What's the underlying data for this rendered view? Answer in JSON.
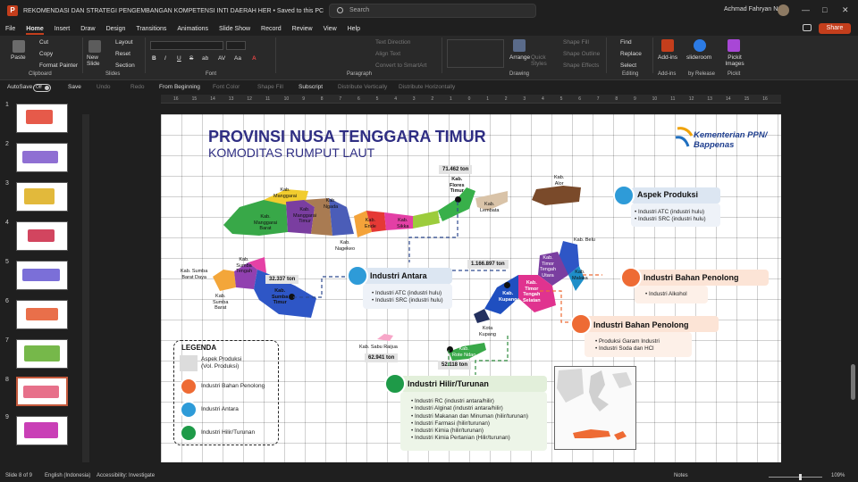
{
  "window": {
    "app_letter": "P",
    "doc_title": "REKOMENDASI DAN STRATEGI PENGEMBANGAN KOMPETENSI INTI DAERAH HER • Saved to this PC",
    "search_placeholder": "Search",
    "user_name": "Achmad Fahryan Nur",
    "controls": [
      "—",
      "□",
      "✕"
    ]
  },
  "menu": {
    "tabs": [
      "File",
      "Home",
      "Insert",
      "Draw",
      "Design",
      "Transitions",
      "Animations",
      "Slide Show",
      "Record",
      "Review",
      "View",
      "Help"
    ],
    "active": "Home",
    "share_label": "Share"
  },
  "ribbon": {
    "clipboard": {
      "paste": "Paste",
      "cut": "Cut",
      "copy": "Copy",
      "format_painter": "Format Painter",
      "label": "Clipboard"
    },
    "slides": {
      "new_slide": "New Slide",
      "layout": "Layout",
      "reset": "Reset",
      "section": "Section",
      "label": "Slides"
    },
    "font": {
      "label": "Font",
      "buttons": [
        "B",
        "I",
        "U",
        "S",
        "ab",
        "AV",
        "Aa",
        "A"
      ]
    },
    "paragraph": {
      "label": "Paragraph",
      "text_direction": "Text Direction",
      "align_text": "Align Text",
      "convert_smartart": "Convert to SmartArt"
    },
    "drawing": {
      "label": "Drawing",
      "arrange": "Arrange",
      "quick_styles": "Quick Styles",
      "shape_fill": "Shape Fill",
      "shape_outline": "Shape Outline",
      "shape_effects": "Shape Effects"
    },
    "editing": {
      "label": "Editing",
      "find": "Find",
      "replace": "Replace",
      "select": "Select"
    },
    "addins": {
      "label": "Add-ins",
      "addins_btn": "Add-ins",
      "slideroom": "slideroom",
      "by_release": "by Release",
      "pickit": "Pickit Images",
      "pickit_label": "Pickit"
    }
  },
  "qat": {
    "autosave": "AutoSave",
    "autosave_state": "Off",
    "save": "Save",
    "undo": "Undo",
    "redo": "Redo",
    "from_beginning": "From Beginning",
    "font_color": "Font Color",
    "shape_fill": "Shape Fill",
    "subscript": "Subscript",
    "distribute_v": "Distribute Vertically",
    "distribute_h": "Distribute Horizontally"
  },
  "thumbnails": {
    "numbers": [
      "1",
      "2",
      "3",
      "4",
      "5",
      "6",
      "7",
      "8",
      "9"
    ],
    "selected": 8
  },
  "ruler": {
    "ticks": [
      "16",
      "15",
      "14",
      "13",
      "12",
      "11",
      "10",
      "9",
      "8",
      "7",
      "6",
      "5",
      "4",
      "3",
      "2",
      "1",
      "0",
      "1",
      "2",
      "3",
      "4",
      "5",
      "6",
      "7",
      "8",
      "9",
      "10",
      "11",
      "12",
      "13",
      "14",
      "15",
      "16"
    ]
  },
  "slide": {
    "title": "PROVINSI NUSA TENGGARA TIMUR",
    "subtitle": "KOMODITAS RUMPUT LAUT",
    "logo_line1": "Kementerian PPN/",
    "logo_line2": "Bappenas",
    "map_labels": {
      "manggarai": "Kab.\nManggarai",
      "manggarai_barat": "Kab.\nManggarai\nBarat",
      "manggarai_timur": "Kab.\nManggarai\nTimur",
      "ngada": "Kab.\nNgada",
      "nagekeo": "Kab.\nNagekeo",
      "ende": "Kab.\nEnde",
      "sikka": "Kab.\nSikka",
      "flores_timur": "Kab.\nFlores\nTimur",
      "lembata": "Kab.\nLembata",
      "alor": "Kab.\nAlor",
      "belu": "Kab. Belu",
      "ttu": "Kab.\nTimor\nTengah\nUtara",
      "malaka": "Kab.\nMalaka",
      "tts": "Kab.\nTimor\nTengah\nSelatan",
      "kupang": "Kab.\nKupang",
      "kota_kupang": "Kota\nKupang",
      "rote_ndao": "Kab.\nRote Ndao",
      "sabu_raijua": "Kab. Sabu Raijua",
      "sumba_barat_daya": "Kab. Sumba\nBarat Daya",
      "sumba_tengah": "Kab.\nSumba\nTengah",
      "sumba_timur": "Kab.\nSumba\nTimur",
      "sumba_barat": "Kab.\nSumba\nBarat"
    },
    "tonnage": {
      "flores": "71.462 ton",
      "timor": "1.166.897 ton",
      "sumba": "32.337 ton",
      "sabu": "62.941 ton",
      "rote": "52.118 ton"
    },
    "aspek_produksi": {
      "title": "Aspek Produksi",
      "items": [
        "Industri ATC (industri hulu)",
        "Industri SRC (industri hulu)"
      ]
    },
    "industri_antara": {
      "title": "Industri Antara",
      "items": [
        "Industri ATC (industri hulu)",
        "Industri SRC (industri hulu)"
      ]
    },
    "bahan_penolong_1": {
      "title": "Industri Bahan Penolong",
      "items": [
        "Industri Alkohol"
      ]
    },
    "bahan_penolong_2": {
      "title": "Industri Bahan Penolong",
      "items": [
        "Produksi Garam Industri",
        "Industri Soda dan HCl"
      ]
    },
    "hilir": {
      "title": "Industri Hilir/Turunan",
      "items": [
        "Industri RC (industri antara/hilir)",
        "Industri Alginat (industri antara/hilir)",
        "Industri Makanan dan Minuman (hilir/turunan)",
        "Industri Farmasi (hilir/turunan)",
        "Industri Kimia (hilir/turunan)",
        "Industri Kimia Pertanian (Hilir/turunan)"
      ]
    },
    "legend": {
      "title": "LEGENDA",
      "items": [
        "Aspek Produksi\n(Vol. Produksi)",
        "Industri Bahan Penolong",
        "Industri Antara",
        "Industri Hilir/Turunan"
      ]
    },
    "colors": {
      "title": "#2f2e83",
      "blue_box": "#dce6f2",
      "orange_box": "#fce4d6",
      "green_box": "#e2efda"
    }
  },
  "status": {
    "slide_of": "Slide 8 of 9",
    "language": "English (Indonesia)",
    "accessibility": "Accessibility: Investigate",
    "notes": "Notes",
    "zoom": "109%"
  }
}
